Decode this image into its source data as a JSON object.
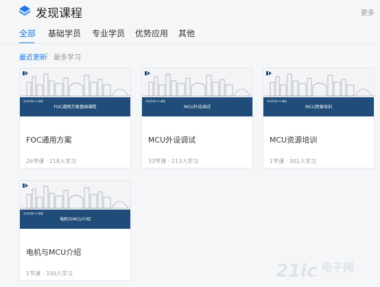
{
  "header": {
    "title": "发现课程",
    "more_label": "更多",
    "brand_color": "#1e78e6"
  },
  "tabs": [
    {
      "label": "全部",
      "active": true
    },
    {
      "label": "基础学员",
      "active": false
    },
    {
      "label": "专业学员",
      "active": false
    },
    {
      "label": "优势应用",
      "active": false
    },
    {
      "label": "其他",
      "active": false
    }
  ],
  "sort": {
    "active_label": "最近更新",
    "inactive_label": "最多学习"
  },
  "courses": [
    {
      "banner_title": "FOC通用方案基础课程",
      "title": "FOC通用方案",
      "lessons": "26节课",
      "learners": "218人学习"
    },
    {
      "banner_title": "MCU外设调试",
      "title": "MCU外设调试",
      "lessons": "33节课",
      "learners": "213人学习"
    },
    {
      "banner_title": "MCU资源培训",
      "title": "MCU资源培训",
      "lessons": "1节课",
      "learners": "301人学习"
    },
    {
      "banner_title": "电机与MCU介绍",
      "title": "电机与MCU介绍",
      "lessons": "1节课",
      "learners": "330人学习"
    }
  ],
  "banner": {
    "series_label": "灵动学堂UV1课程"
  },
  "watermark": {
    "text_a": "21ic",
    "text_b": "电子网"
  }
}
